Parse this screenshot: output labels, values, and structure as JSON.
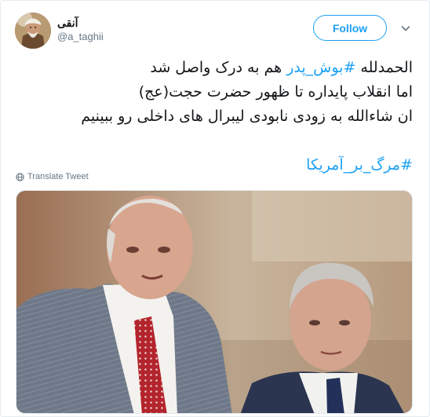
{
  "tweet": {
    "display_name": "آنقی",
    "handle": "@a_taghii",
    "follow_label": "Follow",
    "lines": [
      {
        "hashtag": "#بوش_پدر",
        "before": "الحمدلله ",
        "after": " هم به درک واصل شد"
      },
      {
        "text": "اما انقلاب پایداره تا ظهور حضرت حجت(عج)"
      },
      {
        "text": "ان شاءالله به زودی نابودی لیبرال های داخلی رو ببینیم"
      }
    ],
    "final_hashtag": "#مرگ_بر_آمریکا",
    "translate_label": "Translate Tweet"
  },
  "icons": {
    "more": "chevron-down-icon",
    "translate": "globe-icon"
  },
  "colors": {
    "accent": "#1da1f2",
    "text": "#14171a",
    "muted": "#657786",
    "border": "#e6ecf0"
  }
}
